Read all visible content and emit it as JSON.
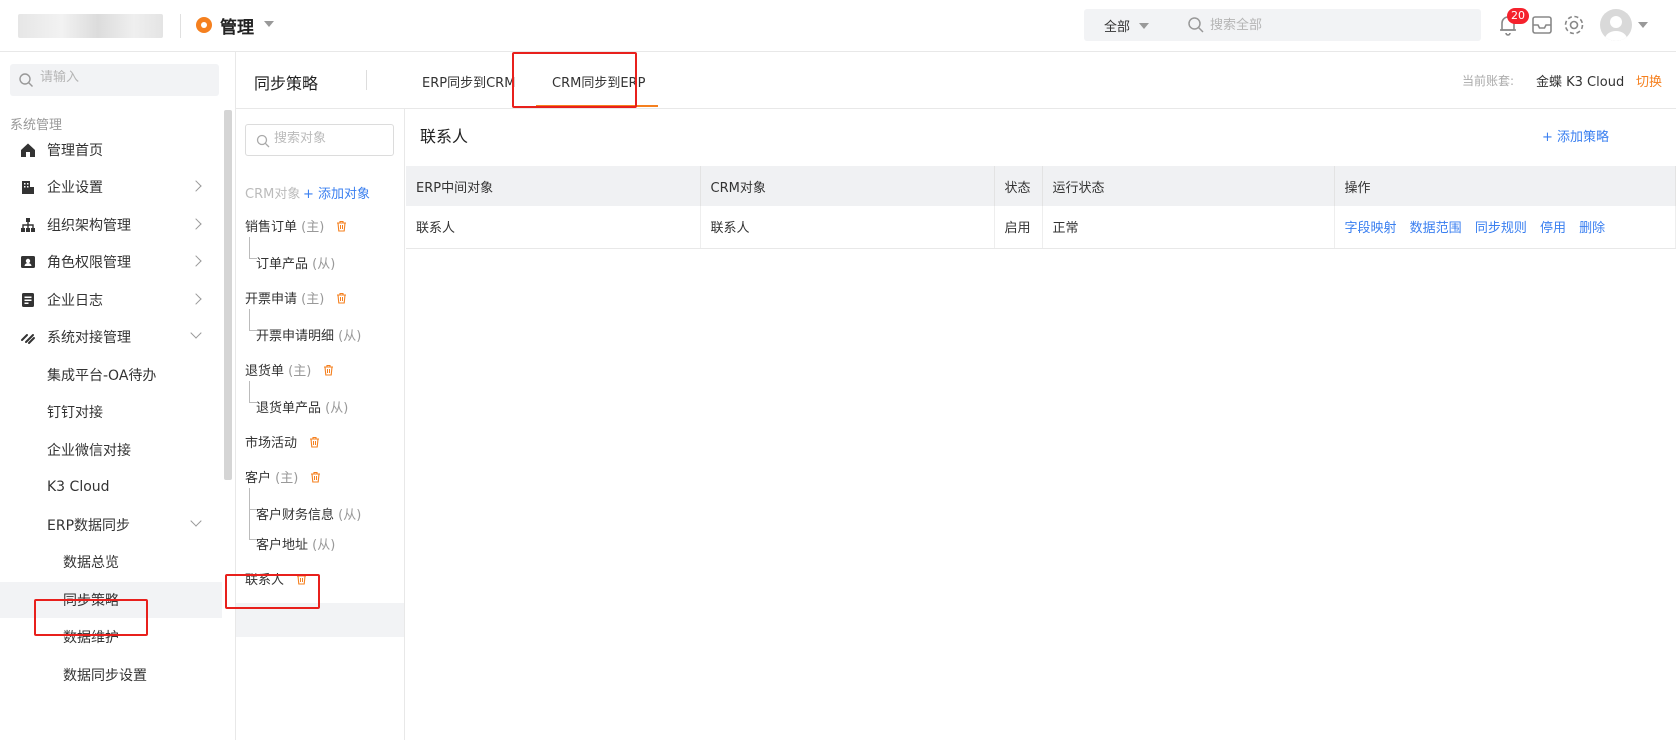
{
  "header": {
    "app_title": "管理",
    "search_scope": "全部",
    "search_placeholder": "搜索全部",
    "notification_count": "20"
  },
  "sidebar": {
    "search_placeholder": "请输入",
    "group_label": "系统管理",
    "items": [
      {
        "label": "管理首页",
        "icon": "home-icon"
      },
      {
        "label": "企业设置",
        "icon": "building-icon"
      },
      {
        "label": "组织架构管理",
        "icon": "org-chart-icon"
      },
      {
        "label": "角色权限管理",
        "icon": "id-card-icon"
      },
      {
        "label": "企业日志",
        "icon": "log-icon"
      },
      {
        "label": "系统对接管理",
        "icon": "link-icon"
      }
    ],
    "sub_items": [
      "集成平台-OA待办",
      "钉钉对接",
      "企业微信对接",
      "K3 Cloud",
      "ERP数据同步"
    ],
    "erp_sub_items": [
      "数据总览",
      "同步策略",
      "数据维护",
      "数据同步设置"
    ],
    "active_item": "同步策略"
  },
  "tabs": {
    "section_title": "同步策略",
    "items": [
      "ERP同步到CRM",
      "CRM同步到ERP"
    ],
    "active": "CRM同步到ERP",
    "account_label": "当前账套:",
    "account_value": "金蝶 K3 Cloud",
    "switch_label": "切换"
  },
  "objects": {
    "search_placeholder": "搜索对象",
    "header_label": "CRM对象",
    "add_label": "+ 添加对象",
    "list": [
      {
        "name": "销售订单",
        "tag": "(主)",
        "children": [
          {
            "name": "订单产品",
            "tag": "(从)"
          }
        ]
      },
      {
        "name": "开票申请",
        "tag": "(主)",
        "children": [
          {
            "name": "开票申请明细",
            "tag": "(从)"
          }
        ]
      },
      {
        "name": "退货单",
        "tag": "(主)",
        "children": [
          {
            "name": "退货单产品",
            "tag": "(从)"
          }
        ]
      },
      {
        "name": "市场活动",
        "tag": "",
        "children": []
      },
      {
        "name": "客户",
        "tag": "(主)",
        "children": [
          {
            "name": "客户财务信息",
            "tag": "(从)"
          },
          {
            "name": "客户地址",
            "tag": "(从)"
          }
        ]
      },
      {
        "name": "联系人",
        "tag": "",
        "children": []
      }
    ],
    "active": "联系人"
  },
  "content": {
    "title": "联系人",
    "add_policy_label": "+ 添加策略",
    "columns": [
      "ERP中间对象",
      "CRM对象",
      "状态",
      "运行状态",
      "操作"
    ],
    "rows": [
      {
        "erp_object": "联系人",
        "crm_object": "联系人",
        "status": "启用",
        "run_status": "正常",
        "actions": [
          "字段映射",
          "数据范围",
          "同步规则",
          "停用",
          "删除"
        ]
      }
    ]
  },
  "colors": {
    "accent": "#f5801f",
    "link": "#3a7ff0",
    "highlight": "#e8201c"
  }
}
